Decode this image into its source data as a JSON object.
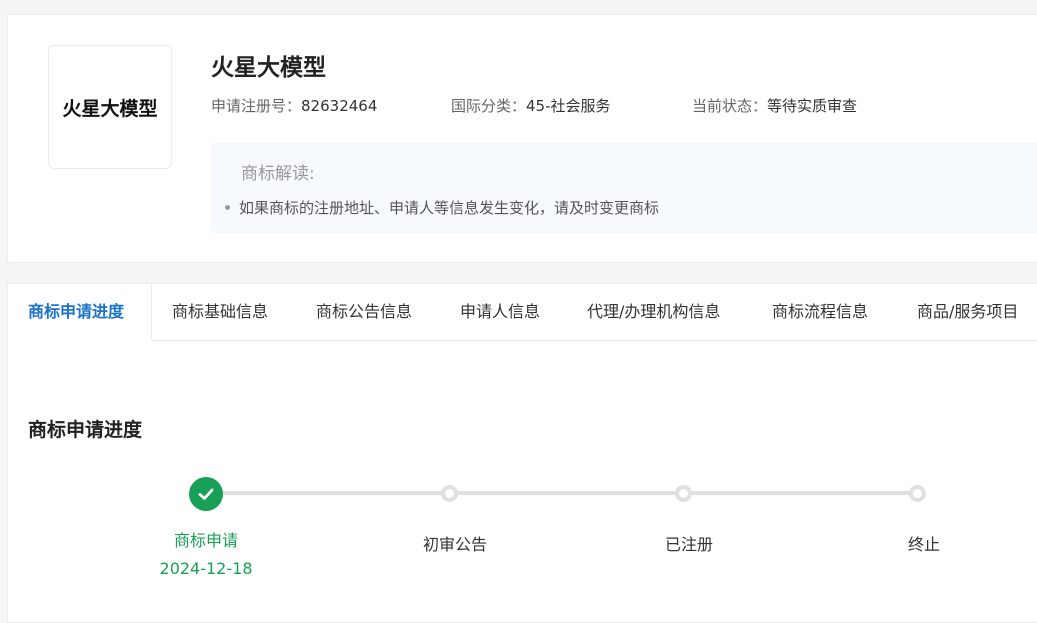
{
  "trademark": {
    "logo_text": "火星大模型",
    "name": "火星大模型",
    "reg_no_label": "申请注册号：",
    "reg_no": "82632464",
    "class_label": "国际分类：",
    "class_value": "45-社会服务",
    "status_label": "当前状态：",
    "status_value": "等待实质审查"
  },
  "interpretation": {
    "title": "商标解读:",
    "items": [
      "如果商标的注册地址、申请人等信息发生变化，请及时变更商标"
    ]
  },
  "tabs": [
    {
      "label": "商标申请进度",
      "active": true
    },
    {
      "label": "商标基础信息"
    },
    {
      "label": "商标公告信息"
    },
    {
      "label": "申请人信息"
    },
    {
      "label": "代理/办理机构信息"
    },
    {
      "label": "商标流程信息"
    },
    {
      "label": "商品/服务项目"
    }
  ],
  "progress": {
    "title": "商标申请进度",
    "steps": [
      {
        "label": "商标申请",
        "date": "2024-12-18",
        "done": true
      },
      {
        "label": "初审公告",
        "done": false
      },
      {
        "label": "已注册",
        "done": false
      },
      {
        "label": "终止",
        "done": false
      }
    ]
  },
  "colors": {
    "accent_blue": "#1a73c8",
    "done_green": "#18a058",
    "track_gray": "#e0e0e0"
  },
  "icons": {
    "step_done": "check-icon"
  }
}
